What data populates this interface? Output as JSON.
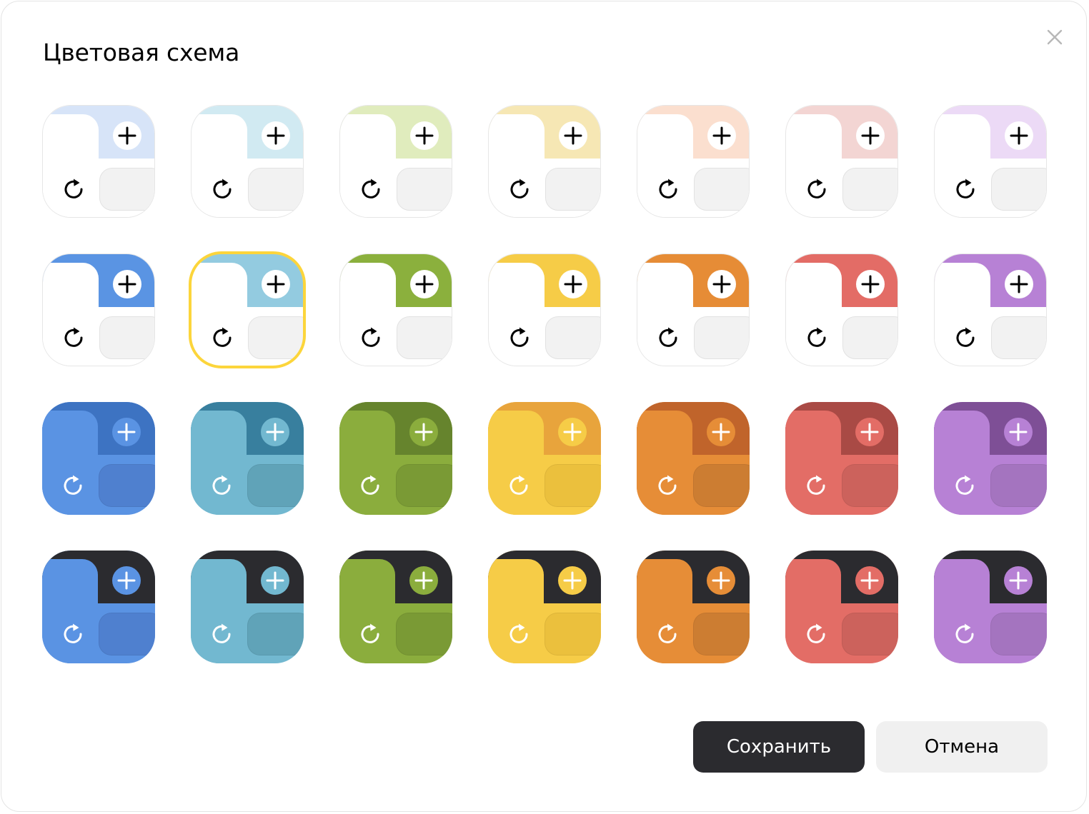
{
  "dialog": {
    "title": "Цветовая схема",
    "close_icon": "close-icon",
    "save_label": "Сохранить",
    "cancel_label": "Отмена"
  },
  "icons": {
    "add": "plus-icon",
    "refresh": "refresh-icon"
  },
  "selected": "light-cyan",
  "colors": {
    "selection_ring": "#fcd53b",
    "save_bg": "#2b2b2f",
    "cancel_bg": "#f0f0f0"
  },
  "schemes": [
    [
      {
        "id": "pastel-blue",
        "style": "pastel",
        "accent": "#d7e4f8"
      },
      {
        "id": "pastel-cyan",
        "style": "pastel",
        "accent": "#d1eaf2"
      },
      {
        "id": "pastel-green",
        "style": "pastel",
        "accent": "#e0ecbd"
      },
      {
        "id": "pastel-yellow",
        "style": "pastel",
        "accent": "#f6e7b4"
      },
      {
        "id": "pastel-orange",
        "style": "pastel",
        "accent": "#fbdfcf"
      },
      {
        "id": "pastel-red",
        "style": "pastel",
        "accent": "#f3d5d3"
      },
      {
        "id": "pastel-purple",
        "style": "pastel",
        "accent": "#ecdaf6"
      }
    ],
    [
      {
        "id": "light-blue",
        "style": "light",
        "accent": "#5a94e3"
      },
      {
        "id": "light-cyan",
        "style": "light",
        "accent": "#93cbe0"
      },
      {
        "id": "light-green",
        "style": "light",
        "accent": "#8bb03d"
      },
      {
        "id": "light-yellow",
        "style": "light",
        "accent": "#f6cc47"
      },
      {
        "id": "light-orange",
        "style": "light",
        "accent": "#e68c36"
      },
      {
        "id": "light-red",
        "style": "light",
        "accent": "#e36c66"
      },
      {
        "id": "light-purple",
        "style": "light",
        "accent": "#b781d5"
      }
    ],
    [
      {
        "id": "color-blue",
        "style": "color",
        "base": "#5a93e3",
        "accent": "#3d73c2",
        "tile": "#4f80cf"
      },
      {
        "id": "color-cyan",
        "style": "color",
        "base": "#72b8d0",
        "accent": "#387f9e",
        "tile": "#60a3b8"
      },
      {
        "id": "color-green",
        "style": "color",
        "base": "#8bad3d",
        "accent": "#66842d",
        "tile": "#7a9a35"
      },
      {
        "id": "color-yellow",
        "style": "color",
        "base": "#f6cc47",
        "accent": "#e8a43c",
        "tile": "#ebc03d"
      },
      {
        "id": "color-orange",
        "style": "color",
        "base": "#e68d37",
        "accent": "#c0642b",
        "tile": "#cc7d32"
      },
      {
        "id": "color-red",
        "style": "color",
        "base": "#e36d66",
        "accent": "#a94a45",
        "tile": "#cc625c"
      },
      {
        "id": "color-purple",
        "style": "color",
        "base": "#b781d5",
        "accent": "#7e4f96",
        "tile": "#a474bf"
      }
    ],
    [
      {
        "id": "dark-blue",
        "style": "dark",
        "base": "#5a93e3",
        "accent": "#2b2b2f",
        "tile": "#4f80cf"
      },
      {
        "id": "dark-cyan",
        "style": "dark",
        "base": "#72b8d0",
        "accent": "#2b2b2f",
        "tile": "#60a3b8"
      },
      {
        "id": "dark-green",
        "style": "dark",
        "base": "#8bad3d",
        "accent": "#2b2b2f",
        "tile": "#7a9a35"
      },
      {
        "id": "dark-yellow",
        "style": "dark",
        "base": "#f6cc47",
        "accent": "#2b2b2f",
        "tile": "#ebc03d"
      },
      {
        "id": "dark-orange",
        "style": "dark",
        "base": "#e68d37",
        "accent": "#2b2b2f",
        "tile": "#cc7d32"
      },
      {
        "id": "dark-red",
        "style": "dark",
        "base": "#e36d66",
        "accent": "#2b2b2f",
        "tile": "#cc625c"
      },
      {
        "id": "dark-purple",
        "style": "dark",
        "base": "#b781d5",
        "accent": "#2b2b2f",
        "tile": "#a474bf"
      }
    ]
  ]
}
